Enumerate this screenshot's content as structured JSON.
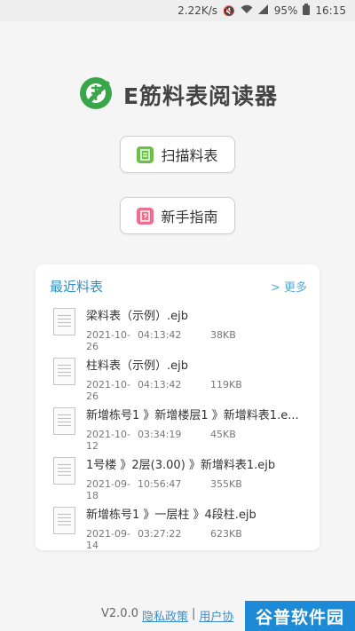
{
  "status_bar": {
    "speed": "2.22K/s",
    "battery": "95%",
    "time": "16:15",
    "icons": [
      "mute-icon",
      "wifi-icon",
      "signal-icon",
      "battery-icon"
    ]
  },
  "brand": {
    "title": "E筋料表阅读器",
    "logo_icon": "rebar-logo-icon",
    "accent_color": "#3aa64a"
  },
  "actions": {
    "scan_label": "扫描料表",
    "guide_label": "新手指南"
  },
  "recent": {
    "title": "最近料表",
    "more_label": "> 更多",
    "files": [
      {
        "name": "梁料表（示例）.ejb",
        "date": "2021-10-26",
        "time": "04:13:42",
        "size": "38KB"
      },
      {
        "name": "柱料表（示例）.ejb",
        "date": "2021-10-26",
        "time": "04:13:42",
        "size": "119KB"
      },
      {
        "name": "新增栋号1 》新增楼层1 》新增料表1.e...",
        "date": "2021-10-12",
        "time": "03:34:19",
        "size": "45KB"
      },
      {
        "name": "1号楼 》2层(3.00) 》新增料表1.ejb",
        "date": "2021-09-18",
        "time": "10:56:47",
        "size": "355KB"
      },
      {
        "name": "新增栋号1 》一层柱 》4段柱.ejb",
        "date": "2021-09-14",
        "time": "03:27:22",
        "size": "623KB"
      }
    ]
  },
  "footer": {
    "version": "V2.0.0",
    "privacy_label": "隐私政策",
    "separator": "|",
    "agreement_label": "用户协"
  },
  "watermark": "谷普软件园"
}
